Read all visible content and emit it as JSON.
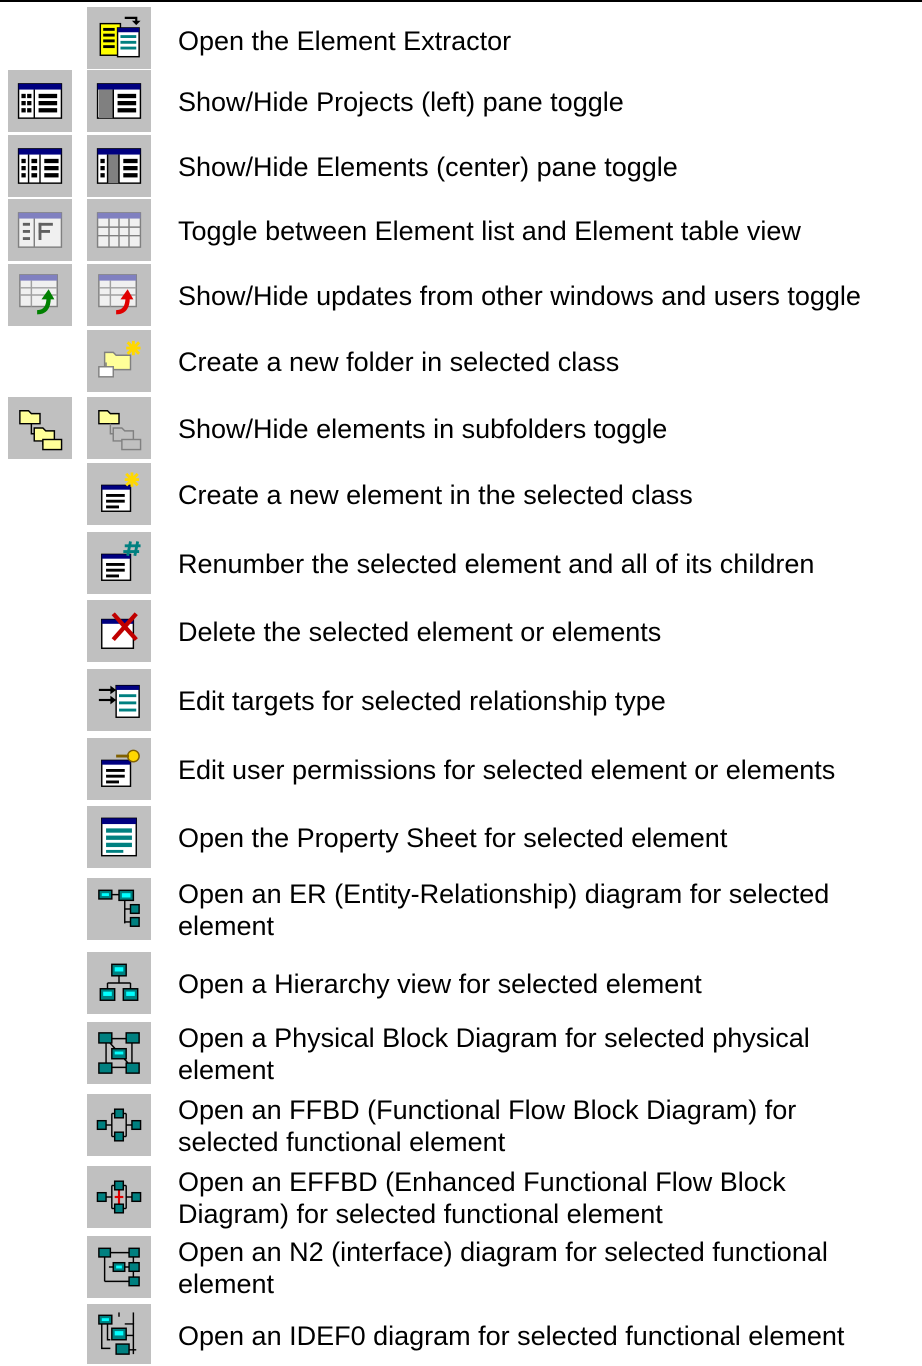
{
  "items": [
    {
      "text": "Open the Element Extractor",
      "icons": [
        "element-extractor-icon"
      ]
    },
    {
      "text": "Show/Hide Projects (left) pane toggle",
      "icons": [
        "projects-pane-shown-icon",
        "projects-pane-hidden-icon"
      ]
    },
    {
      "text": "Show/Hide Elements (center) pane toggle",
      "icons": [
        "elements-pane-shown-icon",
        "elements-pane-hidden-icon"
      ]
    },
    {
      "text": "Toggle between Element list and Element table view",
      "icons": [
        "element-list-view-icon",
        "element-table-view-icon"
      ]
    },
    {
      "text": "Show/Hide updates from other windows and users toggle",
      "icons": [
        "updates-shown-icon",
        "updates-hidden-icon"
      ]
    },
    {
      "text": "Create a new folder in selected class",
      "icons": [
        "new-folder-icon"
      ]
    },
    {
      "text": "Show/Hide elements in subfolders toggle",
      "icons": [
        "subfolders-shown-icon",
        "subfolders-hidden-icon"
      ]
    },
    {
      "text": "Create a new element in the selected class",
      "icons": [
        "new-element-icon"
      ]
    },
    {
      "text": "Renumber the selected element and all of its children",
      "icons": [
        "renumber-icon"
      ]
    },
    {
      "text": "Delete the selected element or elements",
      "icons": [
        "delete-element-icon"
      ]
    },
    {
      "text": "Edit targets for selected relationship type",
      "icons": [
        "edit-targets-icon"
      ]
    },
    {
      "text": "Edit user permissions for selected element or elements",
      "icons": [
        "user-permissions-icon"
      ]
    },
    {
      "text": "Open the Property Sheet for selected element",
      "icons": [
        "property-sheet-icon"
      ]
    },
    {
      "text": "Open an ER (Entity-Relationship) diagram for selected\nelement",
      "icons": [
        "er-diagram-icon"
      ]
    },
    {
      "text": "Open a Hierarchy view for selected element",
      "icons": [
        "hierarchy-view-icon"
      ]
    },
    {
      "text": "Open a Physical Block Diagram for selected physical\nelement",
      "icons": [
        "physical-block-diagram-icon"
      ]
    },
    {
      "text": "Open an FFBD (Functional Flow Block Diagram) for\nselected functional element",
      "icons": [
        "ffbd-icon"
      ]
    },
    {
      "text": "Open an EFFBD (Enhanced Functional Flow Block\nDiagram) for selected functional element",
      "icons": [
        "effbd-icon"
      ]
    },
    {
      "text": "Open an N2 (interface) diagram for selected functional\nelement",
      "icons": [
        "n2-diagram-icon"
      ]
    },
    {
      "text": "Open an IDEF0 diagram for selected functional element",
      "icons": [
        "idef0-diagram-icon"
      ]
    }
  ]
}
